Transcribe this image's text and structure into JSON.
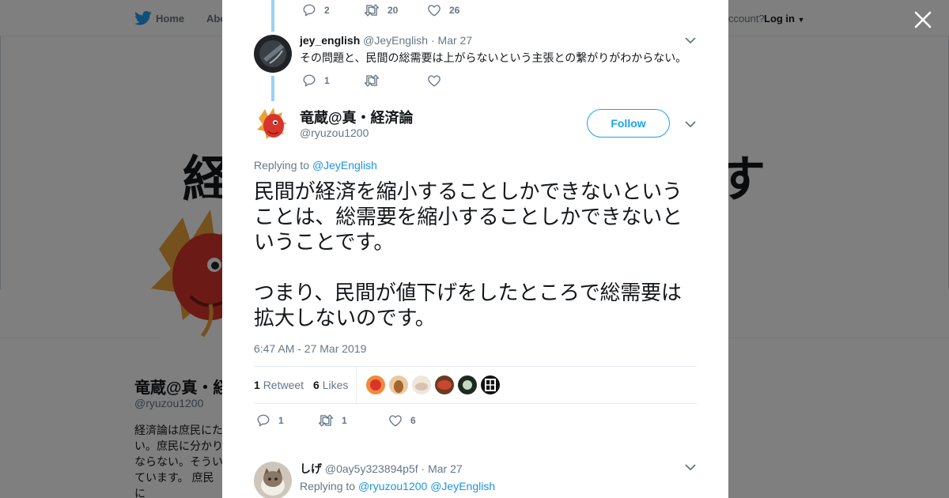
{
  "background": {
    "nav": {
      "home": "Home",
      "about": "Abo",
      "account": "ccount?",
      "login": "Log in"
    },
    "banner": {
      "left_glyph": "経",
      "right_glyph": "す"
    },
    "profile": {
      "name": "竜蔵@真・経",
      "handle": "@ryuzou1200",
      "bio": "経済論は庶民にた\nい。庶民に分かり\nならない。そうい\nています。 庶民に\n経済論で社会実験"
    }
  },
  "modal": {
    "top_tweet_actions": {
      "replies": "2",
      "retweets": "20",
      "likes": "26"
    },
    "reply1": {
      "name": "jey_english",
      "handle": "@JeyEnglish",
      "separator": "·",
      "date": "Mar 27",
      "text": "その問題と、民間の総需要は上がらないという主張との繋がりがわからない。",
      "replies": "1"
    },
    "main_tweet": {
      "name": "竜蔵@真・経済論",
      "handle": "@ryuzou1200",
      "follow_label": "Follow",
      "replying_to_label": "Replying to",
      "replying_to": "@JeyEnglish",
      "paragraph1": "民間が経済を縮小することしかできないということは、総需要を縮小することしかできないということです。",
      "paragraph2": "つまり、民間が値下げをしたところで総需要は拡大しないのです。",
      "timestamp": "6:47 AM - 27 Mar 2019",
      "retweets_count": "1",
      "retweets_label": "Retweet",
      "likes_count": "6",
      "likes_label": "Likes",
      "action_replies": "1",
      "action_retweets": "1",
      "action_likes": "6"
    },
    "reply2": {
      "name": "しげ",
      "handle": "@0ay5y323894p5f",
      "separator": "·",
      "date": "Mar 27",
      "replying_to_label": "Replying to",
      "mention1": "@ryuzou1200",
      "mention2": "@JeyEnglish"
    }
  },
  "colors": {
    "accent": "#1da1f2",
    "text": "#14171a",
    "muted": "#657786",
    "thread": "#9ad1f5"
  }
}
